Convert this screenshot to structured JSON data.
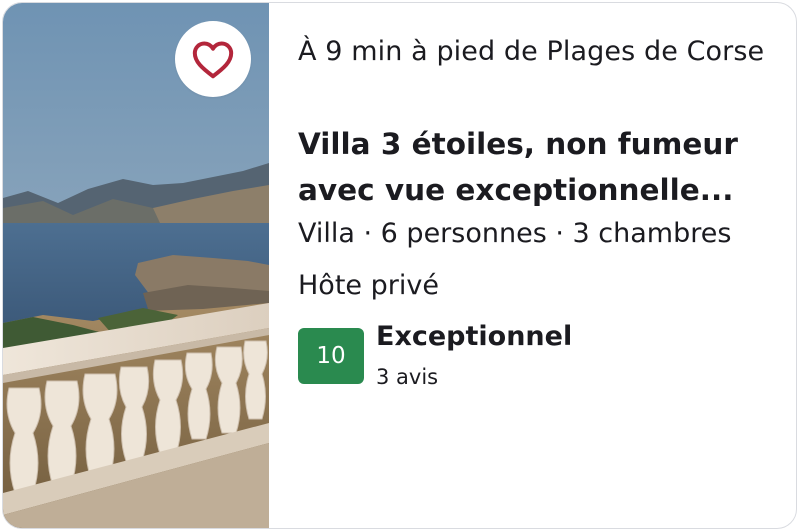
{
  "listing": {
    "distance": "À 9 min à pied de Plages de Corse",
    "title": "Villa 3 étoiles, non fumeur avec vue exceptionnelle...",
    "details": "Villa · 6 personnes · 3 chambres",
    "host": "Hôte privé"
  },
  "rating": {
    "score": "10",
    "label": "Exceptionnel",
    "reviews": "3 avis",
    "badge_color": "#2a8a4f"
  },
  "favorite": {
    "icon": "heart-outline-icon",
    "icon_color": "#b3263b"
  }
}
